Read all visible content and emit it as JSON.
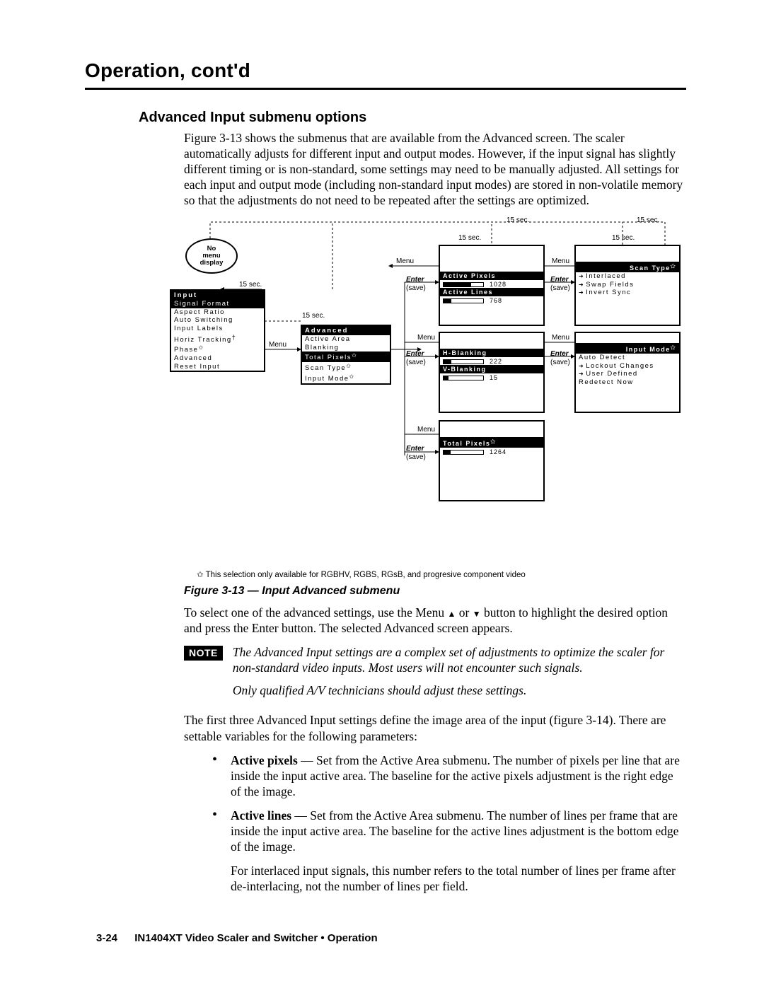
{
  "header": {
    "section_title": "Operation, cont'd"
  },
  "subsection_title": "Advanced Input submenu options",
  "intro": "Figure 3-13 shows the submenus that are available from the Advanced screen.  The scaler automatically adjusts for different input and output modes.  However, if the input signal has slightly different timing or is non-standard, some settings may need to be manually adjusted.  All settings for each input and output mode (including non-standard input modes) are stored in non-volatile memory so that the adjustments do not need to be repeated after the settings are optimized.",
  "diagram": {
    "no_menu_label_1": "No",
    "no_menu_label_2": "menu",
    "no_menu_label_3": "display",
    "timeout": "15 sec.",
    "menu_label": "Menu",
    "enter_label": "Enter",
    "save_label": "(save)",
    "input_menu": {
      "title": "Input",
      "items": [
        "Signal Format",
        "Aspect Ratio",
        "Auto Switching",
        "Input Labels",
        "Horiz Tracking",
        "Phase",
        "Advanced",
        "Reset Input"
      ]
    },
    "advanced_menu": {
      "title": "Advanced",
      "items": [
        "Active Area",
        "Blanking",
        "Total Pixels",
        "Scan Type",
        "Input Mode"
      ]
    },
    "active_area": {
      "row1_label": "Active Pixels",
      "row1_value": "1028",
      "row2_label": "Active Lines",
      "row2_value": "768"
    },
    "blanking": {
      "row1_label": "H-Blanking",
      "row1_value": "222",
      "row2_label": "V-Blanking",
      "row2_value": "15"
    },
    "total_pixels": {
      "row1_label": "Total Pixels",
      "row1_value": "1264"
    },
    "scan_type": {
      "title": "Scan Type",
      "items": [
        "Interlaced",
        "Swap Fields",
        "Invert Sync"
      ]
    },
    "input_mode": {
      "title": "Input Mode",
      "items": [
        "Auto Detect",
        "Lockout Changes",
        "User Defined",
        "Redetect Now"
      ]
    }
  },
  "star_footnote": "✩   This selection only available for RGBHV, RGBS, RGsB, and progresive component video",
  "figure_caption": "Figure 3-13 — Input Advanced submenu",
  "body1_pre": "To select one of the advanced settings, use the Menu ",
  "body1_post": " button to highlight the desired option and press the Enter button.  The selected Advanced screen appears.",
  "or_word": " or ",
  "note_badge": "NOTE",
  "note_p1": "The Advanced Input settings are a complex set of adjustments to optimize the scaler for non-standard video inputs.  Most users will not encounter such signals.",
  "note_p2": "Only qualified A/V technicians should adjust these settings.",
  "body2": "The first three Advanced Input settings define the image area of the input (figure 3-14).  There are settable variables for the following parameters:",
  "bullets": {
    "b1_label": "Active pixels",
    "b1_text": " — Set from the Active Area submenu.  The number of pixels per line that are inside the input active area.  The baseline for the active pixels adjustment is the right edge of the image.",
    "b2_label": "Active lines",
    "b2_text": " — Set from the Active Area submenu.  The number of lines per frame that are inside the input active area.  The baseline for the active lines adjustment is the bottom edge of the image."
  },
  "sub_note": "For interlaced input signals, this number refers to the total number of lines per frame after de-interlacing, not the number of lines per field.",
  "footer": {
    "page": "3-24",
    "title": "IN1404XT Video Scaler and Switcher • Operation"
  }
}
